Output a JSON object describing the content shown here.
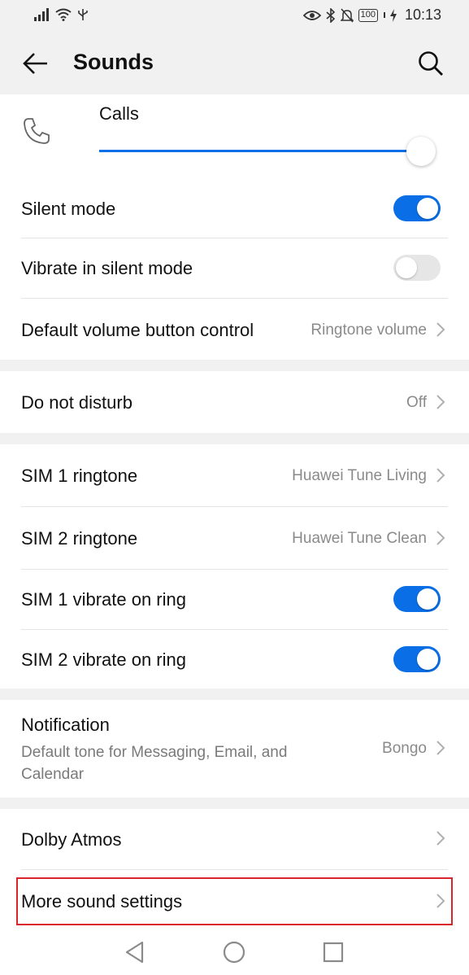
{
  "status_bar": {
    "time": "10:13",
    "battery": "100",
    "icons": [
      "signal-icon",
      "wifi-icon",
      "usb-icon",
      "eye-icon",
      "bluetooth-icon",
      "mute-icon",
      "battery-icon",
      "charging-icon"
    ]
  },
  "header": {
    "title": "Sounds",
    "back_icon": "arrow-left-icon",
    "search_icon": "search-icon"
  },
  "volume": {
    "label": "Calls",
    "icon": "phone-icon",
    "level": 1.0
  },
  "toggles": {
    "silent_mode": {
      "label": "Silent mode",
      "on": true
    },
    "vibrate_silent": {
      "label": "Vibrate in silent mode",
      "on": false
    }
  },
  "volume_button": {
    "label": "Default volume button control",
    "value": "Ringtone volume"
  },
  "dnd": {
    "label": "Do not disturb",
    "value": "Off"
  },
  "sim": {
    "sim1_ringtone": {
      "label": "SIM 1 ringtone",
      "value": "Huawei Tune Living"
    },
    "sim2_ringtone": {
      "label": "SIM 2 ringtone",
      "value": "Huawei Tune Clean"
    },
    "sim1_vibrate": {
      "label": "SIM 1 vibrate on ring",
      "on": true
    },
    "sim2_vibrate": {
      "label": "SIM 2 vibrate on ring",
      "on": true
    }
  },
  "notification": {
    "label": "Notification",
    "description": "Default tone for Messaging, Email, and Calendar",
    "value": "Bongo"
  },
  "more": {
    "dolby_label": "Dolby Atmos",
    "more_sound_label": "More sound settings"
  },
  "colors": {
    "accent": "#0a6ee6",
    "highlight": "#d9242b",
    "background": "#f1f1f1"
  },
  "nav": [
    "back-triangle-icon",
    "home-circle-icon",
    "recents-square-icon"
  ]
}
